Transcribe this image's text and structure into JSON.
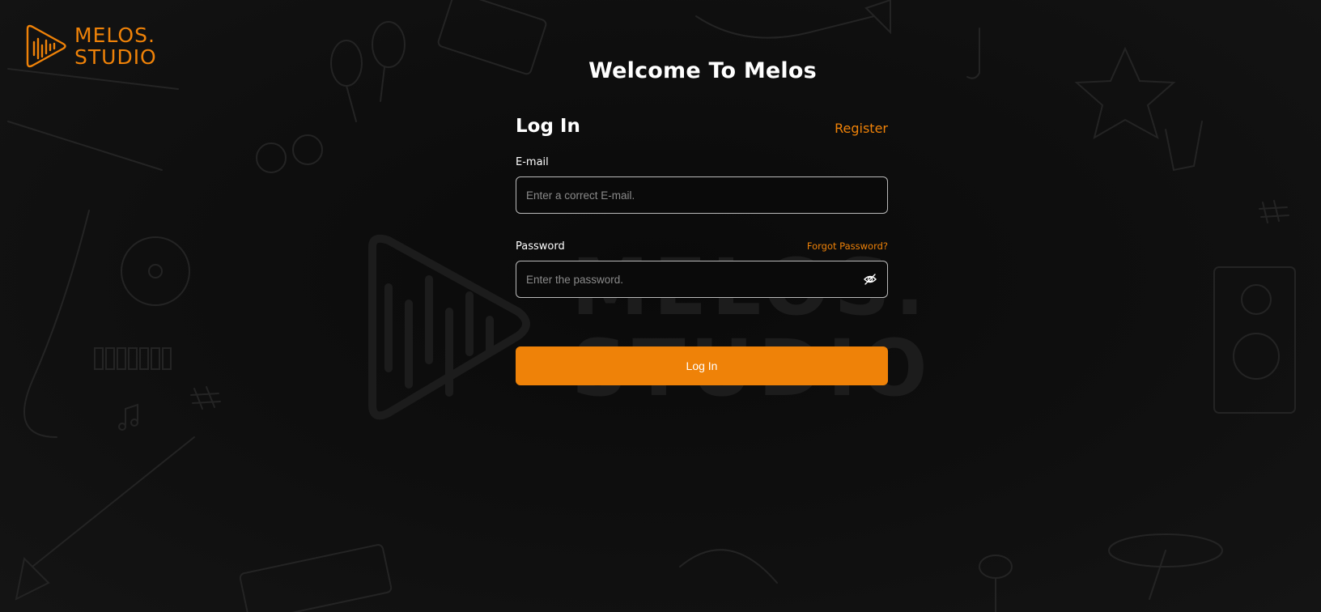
{
  "brand": {
    "name_line1": "MELOS.",
    "name_line2": "STUDIO",
    "accent_color": "#ef8208",
    "logo_icon": "play-wave-logo-icon"
  },
  "watermark": {
    "line1": "MELOS.",
    "line2": "STUDIO"
  },
  "page": {
    "welcome_title": "Welcome To Melos"
  },
  "form": {
    "title": "Log In",
    "register_link": "Register",
    "email": {
      "label": "E-mail",
      "placeholder": "Enter a correct E-mail.",
      "value": ""
    },
    "password": {
      "label": "Password",
      "placeholder": "Enter the password.",
      "value": "",
      "forgot_link": "Forgot Password?",
      "toggle_icon": "eye-off-icon"
    },
    "submit_label": "Log In"
  }
}
